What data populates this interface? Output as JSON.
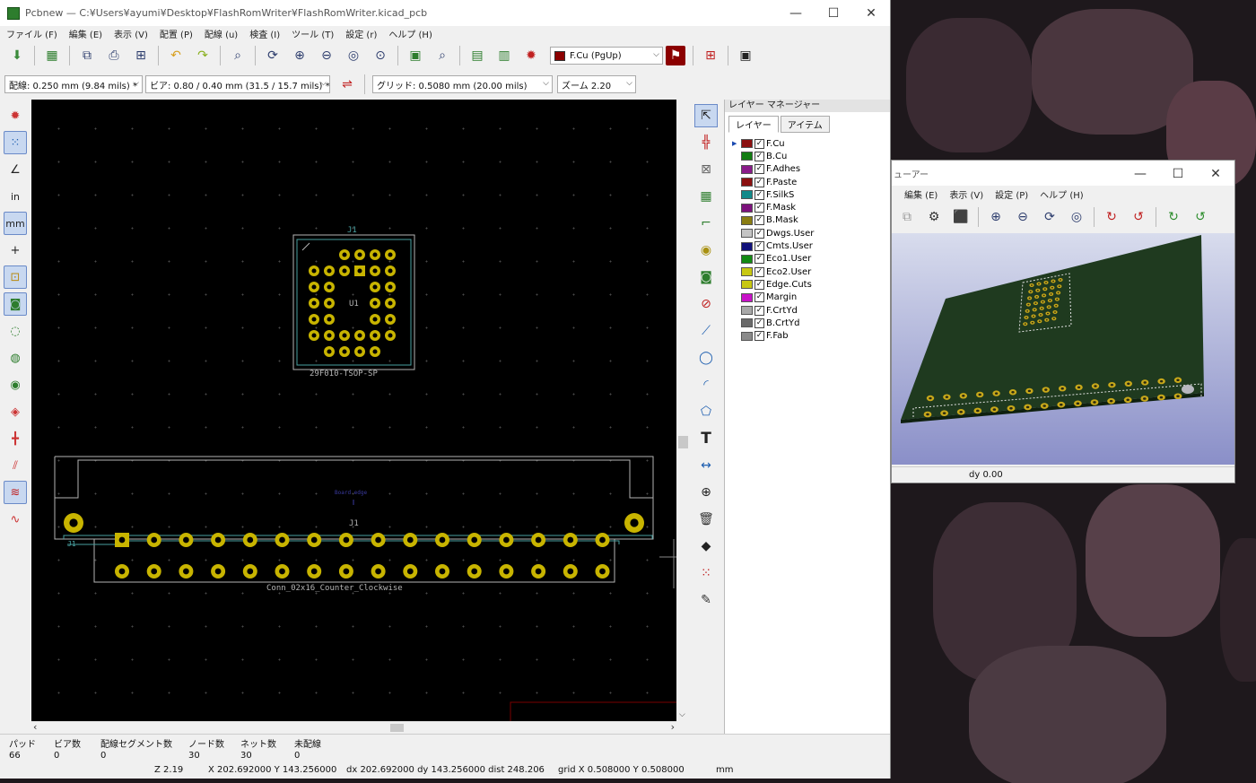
{
  "desktop": {
    "wallpaper": "dark floral abstract"
  },
  "pcbnew": {
    "title": "Pcbnew — C:¥Users¥ayumi¥Desktop¥FlashRomWriter¥FlashRomWriter.kicad_pcb",
    "window_buttons": {
      "minimize": "—",
      "maximize": "☐",
      "close": "✕"
    },
    "menu": [
      "ファイル (F)",
      "編集 (E)",
      "表示 (V)",
      "配置 (P)",
      "配線 (u)",
      "検査 (I)",
      "ツール (T)",
      "設定 (r)",
      "ヘルプ (H)"
    ],
    "toolbar": {
      "layer_select": "F.Cu (PgUp)",
      "layer_color": "#8b0000",
      "track_width": "配線: 0.250 mm (9.84 mils) *",
      "via_size": "ビア: 0.80 / 0.40 mm (31.5 / 15.7 mils) *",
      "grid": "グリッド: 0.5080 mm (20.00 mils)",
      "zoom": "ズーム 2.20"
    },
    "canvas": {
      "ic_ref_top": "J1",
      "ic_ref_center": "U1",
      "ic_value": "29F010-TSOP-SP",
      "conn_ref": "J1",
      "conn_left_label": "J1",
      "conn_value": "Conn_02x16_Counter_Clockwise",
      "board_edge_label": "Board edge"
    },
    "layer_manager": {
      "title": "レイヤー マネージャー",
      "tabs": [
        "レイヤー",
        "アイテム"
      ],
      "layers": [
        {
          "name": "F.Cu",
          "color": "#8b1010",
          "checked": true,
          "selected": true
        },
        {
          "name": "B.Cu",
          "color": "#127c12",
          "checked": true
        },
        {
          "name": "F.Adhes",
          "color": "#8a1b8a",
          "checked": true
        },
        {
          "name": "F.Paste",
          "color": "#8b1010",
          "checked": true
        },
        {
          "name": "F.SilkS",
          "color": "#128a8a",
          "checked": true
        },
        {
          "name": "F.Mask",
          "color": "#7d127d",
          "checked": true
        },
        {
          "name": "B.Mask",
          "color": "#8a7d12",
          "checked": true
        },
        {
          "name": "Dwgs.User",
          "color": "#c4c4c4",
          "checked": true
        },
        {
          "name": "Cmts.User",
          "color": "#10107a",
          "checked": true
        },
        {
          "name": "Eco1.User",
          "color": "#128a12",
          "checked": true
        },
        {
          "name": "Eco2.User",
          "color": "#c8c812",
          "checked": true
        },
        {
          "name": "Edge.Cuts",
          "color": "#c8c812",
          "checked": true
        },
        {
          "name": "Margin",
          "color": "#c812c8",
          "checked": true
        },
        {
          "name": "F.CrtYd",
          "color": "#a8a8a8",
          "checked": true
        },
        {
          "name": "B.CrtYd",
          "color": "#6a6a6a",
          "checked": true
        },
        {
          "name": "F.Fab",
          "color": "#8a8a8a",
          "checked": true
        }
      ]
    },
    "status": {
      "headers": [
        "パッド",
        "ビア数",
        "配線セグメント数",
        "ノード数",
        "ネット数",
        "未配線"
      ],
      "values": [
        "66",
        "0",
        "0",
        "30",
        "30",
        "0"
      ],
      "zoom": "Z 2.19",
      "abs": "X 202.692000  Y 143.256000",
      "rel": "dx 202.692000  dy 143.256000  dist 248.206",
      "grid": "grid X 0.508000  Y 0.508000",
      "units": "mm"
    }
  },
  "viewer3d": {
    "title": "ューアー",
    "window_buttons": {
      "minimize": "—",
      "maximize": "☐",
      "close": "✕"
    },
    "menu": [
      "編集 (E)",
      "表示 (V)",
      "設定 (P)",
      "ヘルプ (H)"
    ],
    "status": "dy 0.00"
  }
}
